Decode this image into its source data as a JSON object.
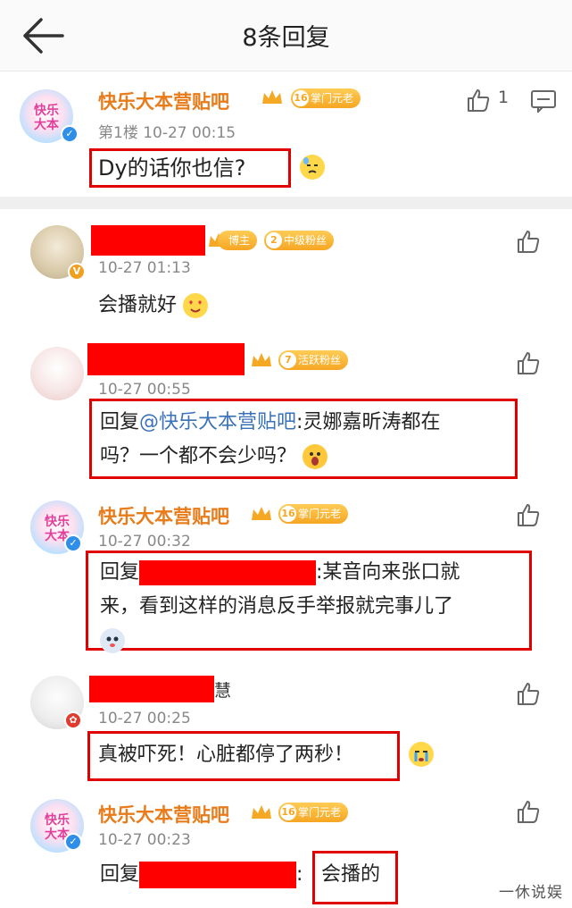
{
  "header": {
    "title": "8条回复"
  },
  "main_post": {
    "username": "快乐大本营贴吧",
    "level_tag": "掌门元老",
    "level_num": "16",
    "floor_time": "第1楼 10-27 00:15",
    "like_count": "1",
    "text": "Dy的话你也信?"
  },
  "replies": [
    {
      "username": "",
      "tag1": "博主",
      "tag2": "中级粉丝",
      "tag2_num": "2",
      "time": "10-27 01:13",
      "text": "会播就好"
    },
    {
      "username": "",
      "tag1": "活跃粉丝",
      "tag1_num": "7",
      "time": "10-27 00:55",
      "reply_prefix": "回复",
      "mention": "@快乐大本营贴吧",
      "text_line1": ":灵娜嘉昕涛都在",
      "text_line2": "吗？一个都不会少吗？"
    },
    {
      "username": "快乐大本营贴吧",
      "tag1": "掌门元老",
      "tag1_num": "16",
      "time": "10-27 00:32",
      "reply_prefix": "回复",
      "text_line1": ":某音向来张口就",
      "text_line2": "来，看到这样的消息反手举报就完事儿了"
    },
    {
      "username_suffix": "慧",
      "time": "10-27 00:25",
      "text": "真被吓死！心脏都停了两秒！"
    },
    {
      "username": "快乐大本营贴吧",
      "tag1": "掌门元老",
      "tag1_num": "16",
      "time": "10-27 00:23",
      "reply_prefix": "回复",
      "text": "会播的"
    }
  ],
  "watermark": "一休说娱",
  "colors": {
    "username": "#e87b1a",
    "mention": "#3a72b8",
    "redaction": "#ff0000",
    "outline": "#e00000"
  }
}
